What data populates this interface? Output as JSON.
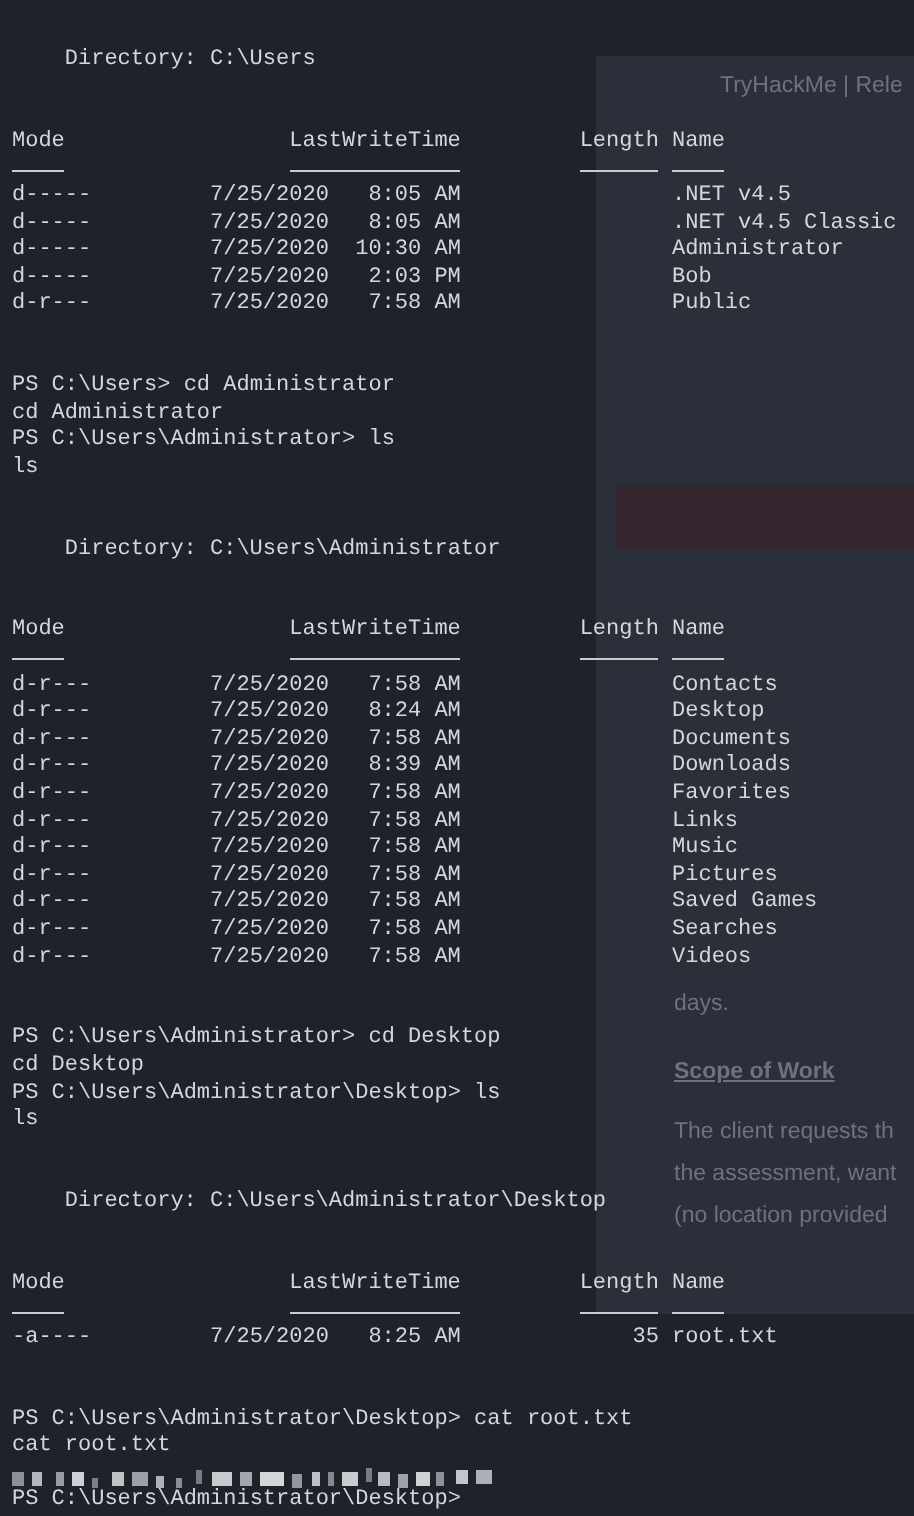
{
  "background_page": {
    "tab_title": "TryHackMe | Rele",
    "paragraphs": [
      {
        "kind": "text",
        "text": "days."
      },
      {
        "kind": "heading",
        "text": "Scope of Work"
      },
      {
        "kind": "text",
        "text": "The client requests th"
      },
      {
        "kind": "text",
        "text": "the assessment, want"
      },
      {
        "kind": "text",
        "text": "(no location provided"
      }
    ]
  },
  "terminal": {
    "blocks": [
      {
        "kind": "directory",
        "text": "Directory: C:\\Users"
      },
      {
        "kind": "table",
        "columns": [
          "Mode",
          "LastWriteTime",
          "Length",
          "Name"
        ],
        "rows": [
          {
            "mode": "d-----",
            "date": "7/25/2020",
            "time": "8:05 AM",
            "name": ".NET v4.5"
          },
          {
            "mode": "d-----",
            "date": "7/25/2020",
            "time": "8:05 AM",
            "name": ".NET v4.5 Classic"
          },
          {
            "mode": "d-----",
            "date": "7/25/2020",
            "time": "10:30 AM",
            "name": "Administrator"
          },
          {
            "mode": "d-----",
            "date": "7/25/2020",
            "time": "2:03 PM",
            "name": "Bob"
          },
          {
            "mode": "d-r---",
            "date": "7/25/2020",
            "time": "7:58 AM",
            "name": "Public"
          }
        ]
      },
      {
        "kind": "line",
        "text": "PS C:\\Users> cd Administrator"
      },
      {
        "kind": "line",
        "text": "cd Administrator"
      },
      {
        "kind": "line",
        "text": "PS C:\\Users\\Administrator> ls"
      },
      {
        "kind": "line",
        "text": "ls"
      },
      {
        "kind": "directory",
        "text": "Directory: C:\\Users\\Administrator"
      },
      {
        "kind": "table",
        "columns": [
          "Mode",
          "LastWriteTime",
          "Length",
          "Name"
        ],
        "rows": [
          {
            "mode": "d-r---",
            "date": "7/25/2020",
            "time": "7:58 AM",
            "name": "Contacts"
          },
          {
            "mode": "d-r---",
            "date": "7/25/2020",
            "time": "8:24 AM",
            "name": "Desktop"
          },
          {
            "mode": "d-r---",
            "date": "7/25/2020",
            "time": "7:58 AM",
            "name": "Documents"
          },
          {
            "mode": "d-r---",
            "date": "7/25/2020",
            "time": "8:39 AM",
            "name": "Downloads"
          },
          {
            "mode": "d-r---",
            "date": "7/25/2020",
            "time": "7:58 AM",
            "name": "Favorites"
          },
          {
            "mode": "d-r---",
            "date": "7/25/2020",
            "time": "7:58 AM",
            "name": "Links"
          },
          {
            "mode": "d-r---",
            "date": "7/25/2020",
            "time": "7:58 AM",
            "name": "Music"
          },
          {
            "mode": "d-r---",
            "date": "7/25/2020",
            "time": "7:58 AM",
            "name": "Pictures"
          },
          {
            "mode": "d-r---",
            "date": "7/25/2020",
            "time": "7:58 AM",
            "name": "Saved Games"
          },
          {
            "mode": "d-r---",
            "date": "7/25/2020",
            "time": "7:58 AM",
            "name": "Searches"
          },
          {
            "mode": "d-r---",
            "date": "7/25/2020",
            "time": "7:58 AM",
            "name": "Videos"
          }
        ]
      },
      {
        "kind": "line",
        "text": "PS C:\\Users\\Administrator> cd Desktop"
      },
      {
        "kind": "line",
        "text": "cd Desktop"
      },
      {
        "kind": "line",
        "text": "PS C:\\Users\\Administrator\\Desktop> ls"
      },
      {
        "kind": "line",
        "text": "ls"
      },
      {
        "kind": "directory",
        "text": "Directory: C:\\Users\\Administrator\\Desktop"
      },
      {
        "kind": "table",
        "columns": [
          "Mode",
          "LastWriteTime",
          "Length",
          "Name"
        ],
        "rows": [
          {
            "mode": "-a----",
            "date": "7/25/2020",
            "time": "8:25 AM",
            "length": "35",
            "name": "root.txt"
          }
        ]
      },
      {
        "kind": "line",
        "text": "PS C:\\Users\\Administrator\\Desktop> cat root.txt"
      },
      {
        "kind": "line",
        "text": "cat root.txt"
      },
      {
        "kind": "redacted"
      },
      {
        "kind": "line",
        "text": "PS C:\\Users\\Administrator\\Desktop>"
      }
    ]
  }
}
